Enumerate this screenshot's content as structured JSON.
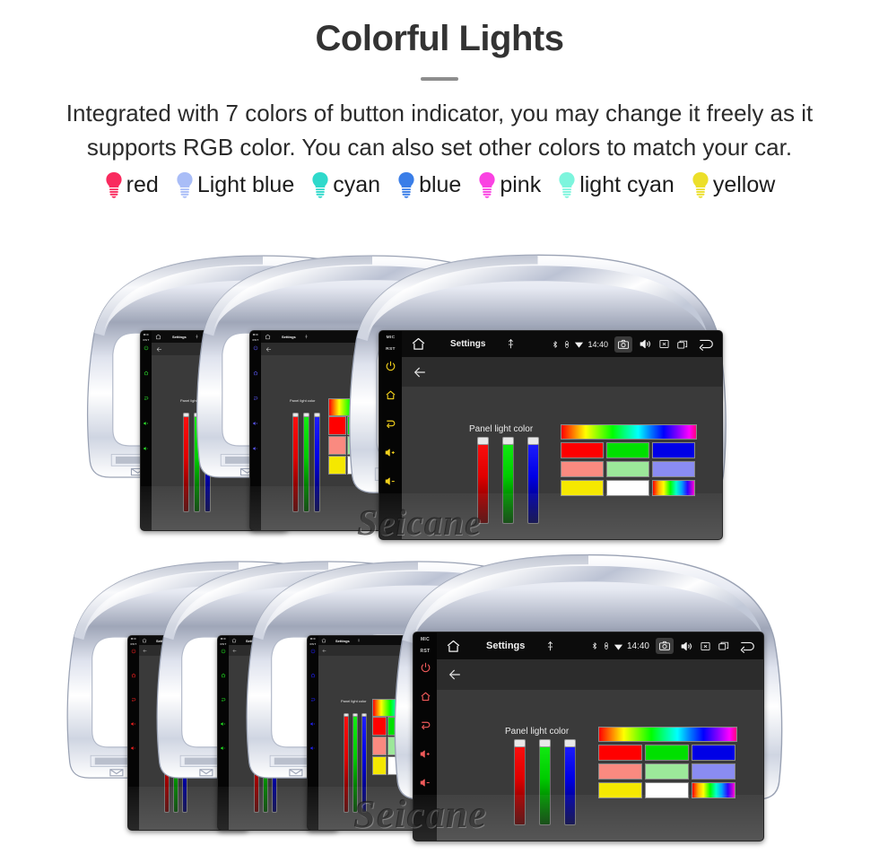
{
  "header": {
    "title": "Colorful Lights",
    "subtitle": "Integrated with 7 colors of button indicator, you may change it freely as it supports RGB color. You can also set other colors to match your car."
  },
  "legend": {
    "items": [
      {
        "label": "red",
        "color": "#f92a5e"
      },
      {
        "label": "Light blue",
        "color": "#a9bdf7"
      },
      {
        "label": "cyan",
        "color": "#2fd9cb"
      },
      {
        "label": "blue",
        "color": "#3a7ee8"
      },
      {
        "label": "pink",
        "color": "#fa42e2"
      },
      {
        "label": "light cyan",
        "color": "#7df5dd"
      },
      {
        "label": "yellow",
        "color": "#ecdf2a"
      }
    ]
  },
  "screen": {
    "statusbar": {
      "home_icon": "home-icon",
      "title": "Settings",
      "mic_icon": "mic-icon",
      "bluetooth_icon": "bluetooth-icon",
      "location_icon": "location-icon",
      "wifi_icon": "wifi-icon",
      "time": "14:40",
      "camera_icon": "camera-icon",
      "volume_icon": "volume-icon",
      "close_icon": "close-box-icon",
      "recents_icon": "recent-apps-icon",
      "back_icon": "back-arrow-icon"
    },
    "actionbar": {
      "back_icon": "back-arrow-icon"
    },
    "content": {
      "panel_label": "Panel light color",
      "sliders": [
        {
          "name": "red-slider",
          "value": 96,
          "color": "#ff0000"
        },
        {
          "name": "green-slider",
          "value": 96,
          "color": "#00ff00"
        },
        {
          "name": "blue-slider",
          "value": 96,
          "color": "#0000ff"
        }
      ],
      "swatches_row1": [
        {
          "name": "rainbow-gradient-swatch",
          "color": "rainbow-wide"
        }
      ],
      "swatches": [
        {
          "name": "swatch-red",
          "color": "#ff0000"
        },
        {
          "name": "swatch-green",
          "color": "#00e000"
        },
        {
          "name": "swatch-blue",
          "color": "#0000e6"
        },
        {
          "name": "swatch-salmon",
          "color": "#fa8a80"
        },
        {
          "name": "swatch-lightgreen",
          "color": "#9ce89a"
        },
        {
          "name": "swatch-periwinkle",
          "color": "#8a8cf2"
        },
        {
          "name": "swatch-yellow",
          "color": "#f5e800"
        },
        {
          "name": "swatch-white",
          "color": "#ffffff"
        },
        {
          "name": "swatch-rainbow",
          "color": "rainbow-small"
        }
      ]
    },
    "rail": {
      "mic_label": "MIC",
      "rst_label": "RST",
      "buttons": [
        "power-icon",
        "home-icon",
        "back-icon",
        "volume-up-icon",
        "volume-down-icon"
      ]
    }
  },
  "rows": {
    "top": {
      "units": [
        {
          "rail_color": "#2ee22e",
          "name": "radio-unit-green"
        },
        {
          "rail_color": "#5a57f0",
          "name": "radio-unit-blue-violet"
        },
        {
          "rail_color": "#f2d01c",
          "name": "radio-unit-yellow"
        }
      ],
      "watermark": "Seicane"
    },
    "bottom": {
      "units": [
        {
          "rail_color": "#f02020",
          "name": "radio-unit-red"
        },
        {
          "rail_color": "#20e020",
          "name": "radio-unit-green"
        },
        {
          "rail_color": "#2020f0",
          "name": "radio-unit-blue"
        },
        {
          "rail_color": "#f05a5a",
          "name": "radio-unit-light-red"
        }
      ],
      "watermark": "Seicane"
    }
  }
}
